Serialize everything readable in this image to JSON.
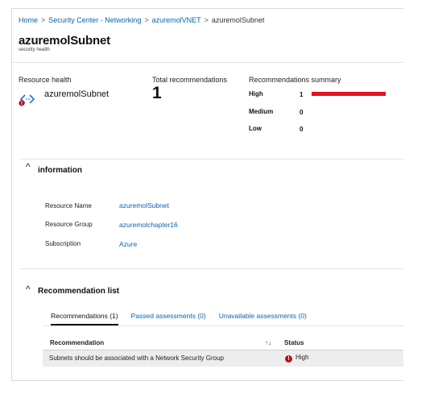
{
  "breadcrumb": [
    "Home",
    "Security Center - Networking",
    "azuremolVNET",
    "azuremolSubnet"
  ],
  "header": {
    "title": "azuremolSubnet",
    "subtitle": "security health"
  },
  "resource_health": {
    "label": "Resource health",
    "resource_name": "azuremolSubnet",
    "icon": "subnet-icon",
    "alert_icon": "error-badge-icon"
  },
  "total_recommendations": {
    "label": "Total recommendations",
    "count": "1"
  },
  "summary": {
    "label": "Recommendations summary",
    "rows": [
      {
        "label": "High",
        "value": "1"
      },
      {
        "label": "Medium",
        "value": "0"
      },
      {
        "label": "Low",
        "value": "0"
      }
    ],
    "high_color": "#e3131c"
  },
  "information": {
    "title": "information",
    "rows": [
      {
        "label": "Resource Name",
        "value": "azuremolSubnet"
      },
      {
        "label": "Resource Group",
        "value": "azuremolchapter16"
      },
      {
        "label": "Subscription",
        "value": "Azure"
      }
    ]
  },
  "recommendation_list": {
    "title": "Recommendation list",
    "tabs": [
      "Recommendations (1)",
      "Passed assessments (0)",
      "Unavailable assessments (0)"
    ],
    "columns": [
      "Recommendation",
      "Status"
    ],
    "sort_icon": "↑↓",
    "rows": [
      {
        "recommendation": "Subnets should be associated with a Network Security Group",
        "status": "High",
        "status_icon": "!"
      }
    ]
  },
  "colors": {
    "link": "#0a64ad",
    "error": "#b5121b"
  }
}
